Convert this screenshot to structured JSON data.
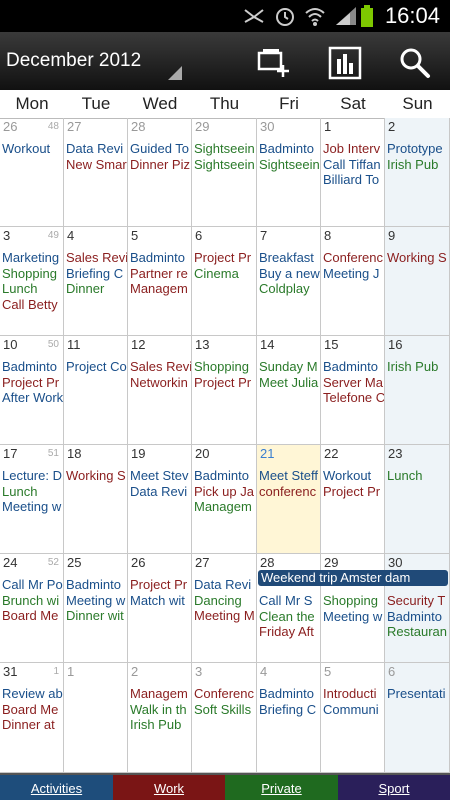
{
  "status_bar": {
    "time": "16:04"
  },
  "action_bar": {
    "title": "December 2012",
    "new_event_icon": "new-event-icon",
    "stats_icon": "statistics-icon",
    "search_icon": "search-icon"
  },
  "weekdays": [
    "Mon",
    "Tue",
    "Wed",
    "Thu",
    "Fri",
    "Sat",
    "Sun"
  ],
  "weeks": [
    {
      "week_no": "48",
      "days": [
        {
          "num": "26",
          "other": true,
          "events": [
            {
              "t": "Workout",
              "c": "activities"
            }
          ]
        },
        {
          "num": "27",
          "other": true,
          "events": [
            {
              "t": "Data Revi",
              "c": "activities"
            },
            {
              "t": "New Smar",
              "c": "work"
            }
          ]
        },
        {
          "num": "28",
          "other": true,
          "events": [
            {
              "t": "Guided To",
              "c": "activities"
            },
            {
              "t": "Dinner Piz",
              "c": "work"
            }
          ]
        },
        {
          "num": "29",
          "other": true,
          "events": [
            {
              "t": "Sightseein",
              "c": "private"
            },
            {
              "t": "Sightseein",
              "c": "private"
            }
          ]
        },
        {
          "num": "30",
          "other": true,
          "events": [
            {
              "t": "Badminto",
              "c": "activities"
            },
            {
              "t": "Sightseein",
              "c": "private"
            }
          ]
        },
        {
          "num": "1",
          "events": [
            {
              "t": "Job Interv",
              "c": "work"
            },
            {
              "t": "Call Tiffan",
              "c": "activities"
            },
            {
              "t": "Billiard To",
              "c": "activities"
            }
          ]
        },
        {
          "num": "2",
          "events": [
            {
              "t": "Prototype",
              "c": "activities"
            },
            {
              "t": "Irish Pub",
              "c": "private"
            }
          ]
        }
      ]
    },
    {
      "week_no": "49",
      "days": [
        {
          "num": "3",
          "events": [
            {
              "t": "Marketing",
              "c": "activities"
            },
            {
              "t": "Shopping",
              "c": "private"
            },
            {
              "t": "Lunch",
              "c": "private"
            },
            {
              "t": "Call Betty",
              "c": "work"
            }
          ]
        },
        {
          "num": "4",
          "events": [
            {
              "t": "Sales Revi",
              "c": "work"
            },
            {
              "t": "Briefing C",
              "c": "activities"
            },
            {
              "t": "Dinner",
              "c": "private"
            }
          ]
        },
        {
          "num": "5",
          "events": [
            {
              "t": "Badminto",
              "c": "activities"
            },
            {
              "t": "Partner re",
              "c": "work"
            },
            {
              "t": "Managem",
              "c": "work"
            }
          ]
        },
        {
          "num": "6",
          "events": [
            {
              "t": "Project Pr",
              "c": "work"
            },
            {
              "t": "Cinema",
              "c": "private"
            }
          ]
        },
        {
          "num": "7",
          "events": [
            {
              "t": "Breakfast",
              "c": "activities"
            },
            {
              "t": "Buy a new",
              "c": "activities"
            },
            {
              "t": "Coldplay",
              "c": "private"
            }
          ]
        },
        {
          "num": "8",
          "events": [
            {
              "t": "Conferenc",
              "c": "work"
            },
            {
              "t": "Meeting J",
              "c": "activities"
            }
          ]
        },
        {
          "num": "9",
          "events": [
            {
              "t": "Working S",
              "c": "work"
            }
          ]
        }
      ]
    },
    {
      "week_no": "50",
      "days": [
        {
          "num": "10",
          "events": [
            {
              "t": "Badminto",
              "c": "activities"
            },
            {
              "t": "Project Pr",
              "c": "work"
            },
            {
              "t": "After Work",
              "c": "activities"
            }
          ]
        },
        {
          "num": "11",
          "events": [
            {
              "t": "Project Co",
              "c": "activities"
            }
          ]
        },
        {
          "num": "12",
          "events": [
            {
              "t": "Sales Revi",
              "c": "work"
            },
            {
              "t": "Networkin",
              "c": "work"
            }
          ]
        },
        {
          "num": "13",
          "events": [
            {
              "t": "Shopping",
              "c": "private"
            },
            {
              "t": "Project Pr",
              "c": "work"
            }
          ]
        },
        {
          "num": "14",
          "events": [
            {
              "t": "Sunday M",
              "c": "private"
            },
            {
              "t": "Meet Julia",
              "c": "private"
            }
          ]
        },
        {
          "num": "15",
          "events": [
            {
              "t": "Badminto",
              "c": "activities"
            },
            {
              "t": "Server Ma",
              "c": "work"
            },
            {
              "t": "Telefone C",
              "c": "work"
            }
          ]
        },
        {
          "num": "16",
          "events": [
            {
              "t": "Irish Pub",
              "c": "private"
            }
          ]
        }
      ]
    },
    {
      "week_no": "51",
      "days": [
        {
          "num": "17",
          "events": [
            {
              "t": "Lecture: D",
              "c": "activities"
            },
            {
              "t": "Lunch",
              "c": "private"
            },
            {
              "t": "Meeting w",
              "c": "activities"
            }
          ]
        },
        {
          "num": "18",
          "events": [
            {
              "t": "Working S",
              "c": "work"
            }
          ]
        },
        {
          "num": "19",
          "events": [
            {
              "t": "Meet Stev",
              "c": "activities"
            },
            {
              "t": "Data Revi",
              "c": "activities"
            }
          ]
        },
        {
          "num": "20",
          "events": [
            {
              "t": "Badminto",
              "c": "activities"
            },
            {
              "t": "Pick up Ja",
              "c": "work"
            },
            {
              "t": "Managem",
              "c": "private"
            }
          ]
        },
        {
          "num": "21",
          "today": true,
          "events": [
            {
              "t": "Meet Steff",
              "c": "activities"
            },
            {
              "t": "conferenc",
              "c": "work"
            }
          ]
        },
        {
          "num": "22",
          "events": [
            {
              "t": "Workout",
              "c": "activities"
            },
            {
              "t": "Project Pr",
              "c": "work"
            }
          ]
        },
        {
          "num": "23",
          "events": [
            {
              "t": "Lunch",
              "c": "private"
            }
          ]
        }
      ]
    },
    {
      "week_no": "52",
      "days": [
        {
          "num": "24",
          "events": [
            {
              "t": "Call Mr Po",
              "c": "activities"
            },
            {
              "t": "Brunch wi",
              "c": "private"
            },
            {
              "t": "Board Me",
              "c": "work"
            }
          ]
        },
        {
          "num": "25",
          "events": [
            {
              "t": "Badminto",
              "c": "activities"
            },
            {
              "t": "Meeting w",
              "c": "activities"
            },
            {
              "t": "Dinner wit",
              "c": "private"
            }
          ]
        },
        {
          "num": "26",
          "events": [
            {
              "t": "Project Pr",
              "c": "work"
            },
            {
              "t": "Match wit",
              "c": "activities"
            }
          ]
        },
        {
          "num": "27",
          "events": [
            {
              "t": "Data Revi",
              "c": "activities"
            },
            {
              "t": "Dancing",
              "c": "private"
            },
            {
              "t": "Meeting M",
              "c": "work"
            }
          ]
        },
        {
          "num": "28",
          "events": [
            {
              "t": "Call Mr S",
              "c": "activities"
            },
            {
              "t": "Clean the",
              "c": "private"
            },
            {
              "t": "Friday Aft",
              "c": "work"
            }
          ]
        },
        {
          "num": "29",
          "events": [
            {
              "t": "Shopping",
              "c": "private"
            },
            {
              "t": "Meeting w",
              "c": "activities"
            }
          ]
        },
        {
          "num": "30",
          "events": [
            {
              "t": "Security T",
              "c": "work"
            },
            {
              "t": "Badminto",
              "c": "activities"
            },
            {
              "t": "Restauran",
              "c": "private"
            }
          ]
        }
      ]
    },
    {
      "week_no": "1",
      "days": [
        {
          "num": "31",
          "events": [
            {
              "t": "Review ab",
              "c": "activities"
            },
            {
              "t": "Board Me",
              "c": "work"
            },
            {
              "t": "Dinner at",
              "c": "work"
            }
          ]
        },
        {
          "num": "1",
          "other": true,
          "events": []
        },
        {
          "num": "2",
          "other": true,
          "events": [
            {
              "t": "Managem",
              "c": "work"
            },
            {
              "t": "Walk in th",
              "c": "private"
            },
            {
              "t": "Irish Pub",
              "c": "private"
            }
          ]
        },
        {
          "num": "3",
          "other": true,
          "events": [
            {
              "t": "Conferenc",
              "c": "work"
            },
            {
              "t": "Soft Skills",
              "c": "private"
            }
          ]
        },
        {
          "num": "4",
          "other": true,
          "events": [
            {
              "t": "Badminto",
              "c": "activities"
            },
            {
              "t": "Briefing C",
              "c": "activities"
            }
          ]
        },
        {
          "num": "5",
          "other": true,
          "events": [
            {
              "t": "Introducti",
              "c": "work"
            },
            {
              "t": "Communi",
              "c": "activities"
            }
          ]
        },
        {
          "num": "6",
          "other": true,
          "events": [
            {
              "t": "Presentati",
              "c": "activities"
            }
          ]
        }
      ]
    }
  ],
  "multi_day_event": {
    "label": "Weekend trip Amster dam"
  },
  "legend": [
    {
      "label": "Activities",
      "color": "#1e4d7b"
    },
    {
      "label": "Work",
      "color": "#7a1515"
    },
    {
      "label": "Private",
      "color": "#1f6a1f"
    },
    {
      "label": "Sport",
      "color": "#2a1f5a"
    }
  ]
}
